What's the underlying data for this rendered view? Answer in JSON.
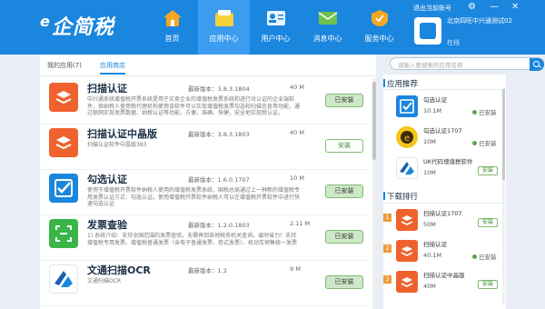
{
  "header": {
    "logo_prefix": "e",
    "logo_text": "企简税",
    "logout": "退出当前账号",
    "nav": [
      {
        "label": "首页",
        "icon": "home-icon"
      },
      {
        "label": "应用中心",
        "icon": "folder-icon"
      },
      {
        "label": "用户中心",
        "icon": "user-card-icon"
      },
      {
        "label": "消息中心",
        "icon": "mail-icon"
      },
      {
        "label": "服务中心",
        "icon": "service-icon"
      }
    ],
    "active_nav": "应用中心",
    "user": {
      "name": "北京四旺中兴通测试02",
      "status": "在线"
    }
  },
  "tabs": {
    "my_apps": "我的应用(7)",
    "app_store": "应用商店"
  },
  "search": {
    "placeholder": "请输入要搜索的应用名称"
  },
  "apps": [
    {
      "title": "扫描认证",
      "version": "最新版本：3.8.3.1804",
      "size": "40 M",
      "desc": "中兴通系统增值税开票系统是用于买卖企业的增值税发票系统和进行对认证的企业端软件，供纳税人使用税代理机构使用该软件可以实现增值税发票勾选和扫描信息等功能，通过联网实现发票数据、纳税认证等功能，方便、准确、快捷，安全地实现税认证。",
      "button": "已安装",
      "installed": true,
      "icon": "scan-certify-icon"
    },
    {
      "title": "扫描认证中晶版",
      "version": "最新版本：3.8.3.1803",
      "size": "40 M",
      "desc": "扫描认证软件中晶版383",
      "button": "安装",
      "installed": false,
      "icon": "scan-certify-zhongjing-icon"
    },
    {
      "title": "勾选认证",
      "version": "最新版本：1.6.0.1707",
      "size": "10 M",
      "desc": "使用于增值税开票软件纳税人使用的增值税发票系统，国税总局通过上一种新的增值税专用发票认证方式：勾选认证。使用增值税开票软件纳税人可以在增值税开票软件中进行快速勾选认证",
      "button": "已安装",
      "installed": true,
      "icon": "checkbox-certify-icon"
    },
    {
      "title": "发票查验",
      "version": "最新版本：1.2.0.1803",
      "size": "2.11 M",
      "desc": "1) 系统介绍：支持全国范围的发票查验，无需再到各地税务机关查询，省时省力！支持增值税专用发票、增值税普通发票（含电子普通发票、卷式发票）、机动车销售统一发票",
      "button": "已安装",
      "installed": true,
      "icon": "invoice-verify-icon"
    },
    {
      "title": "文通扫描OCR",
      "version": "最新版本：1.2",
      "size": "9 M",
      "desc": "文通扫描OCR",
      "button": "已安装",
      "installed": true,
      "icon": "wentong-ocr-icon"
    }
  ],
  "recommend": {
    "title": "应用推荐",
    "items": [
      {
        "name": "勾选认证",
        "size": "10.1M",
        "state": "已安装",
        "installed": true,
        "icon": "checkbox-certify-icon"
      },
      {
        "name": "勾选认证1707",
        "size": "10M",
        "state": "已安装",
        "installed": true,
        "icon": "e-certify-icon"
      },
      {
        "name": "UK代码增值税软件",
        "size": "10M",
        "state": "安装",
        "installed": false,
        "icon": "uk-software-icon"
      }
    ]
  },
  "downloads": {
    "title": "下载排行",
    "items": [
      {
        "rank": "1",
        "name": "扫描认证1707",
        "size": "50M",
        "state": "安装",
        "installed": false,
        "icon": "scan-certify-icon"
      },
      {
        "rank": "2",
        "name": "扫描认证",
        "size": "40.1M",
        "state": "已安装",
        "installed": true,
        "icon": "scan-certify-icon"
      },
      {
        "rank": "3",
        "name": "扫描认证中晶版",
        "size": "40M",
        "state": "安装",
        "installed": false,
        "icon": "scan-certify-icon"
      }
    ]
  },
  "colors": {
    "brand": "#1b86de",
    "active_nav": "#3b9cf0",
    "install_green": "#5aa84a",
    "orange_icon": "#f0622d"
  }
}
